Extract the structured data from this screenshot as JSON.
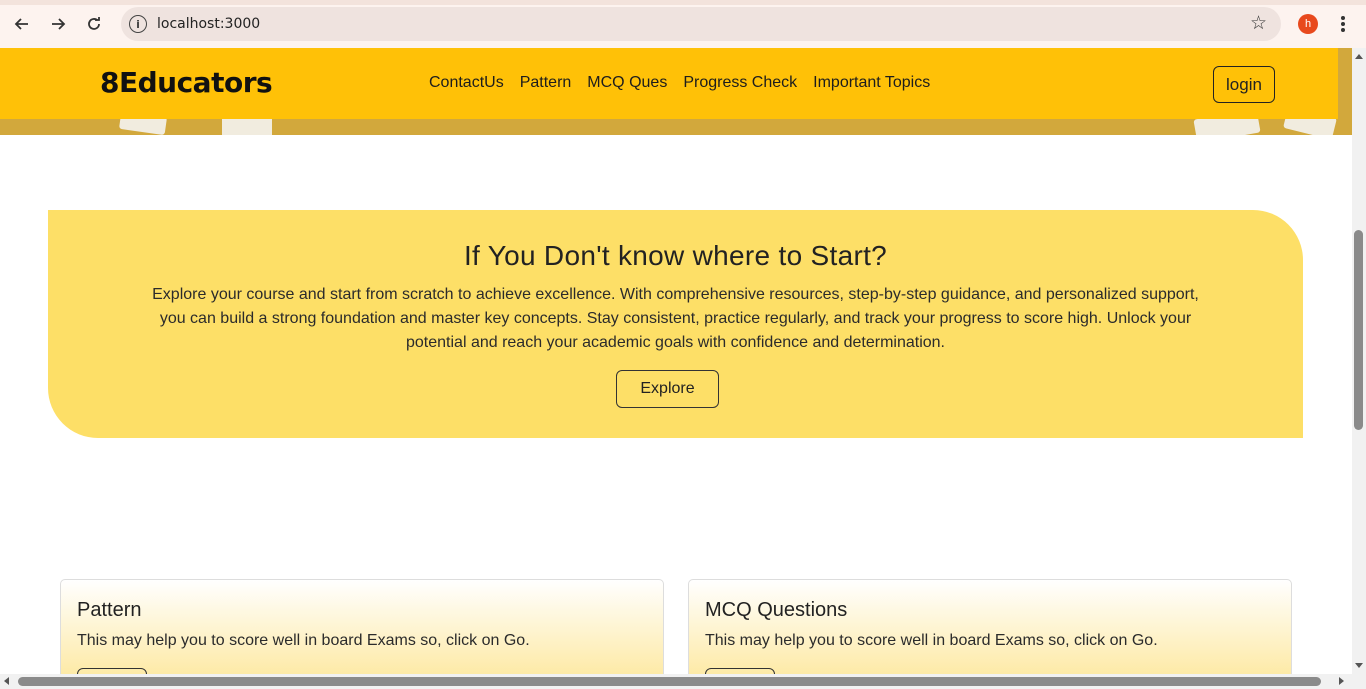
{
  "browser": {
    "url": "localhost:3000",
    "profile_initial": "h",
    "icons": [
      "back-arrow-icon",
      "forward-arrow-icon",
      "reload-icon",
      "info-icon",
      "star-icon",
      "kebab-menu-icon"
    ]
  },
  "navbar": {
    "brand": "8Educators",
    "links": [
      "ContactUs",
      "Pattern",
      "MCQ Ques",
      "Progress Check",
      "Important Topics"
    ],
    "login_label": "login",
    "background": "#ffc107"
  },
  "callout": {
    "title": "If You Don't know where to Start?",
    "body": "Explore your course and start from scratch to achieve excellence. With comprehensive resources, step-by-step guidance, and personalized support, you can build a strong foundation and master key concepts. Stay consistent, practice regularly, and track your progress to score high. Unlock your potential and reach your academic goals with confidence and determination.",
    "button_label": "Explore",
    "background": "#fddf67"
  },
  "cards": [
    {
      "title": "Pattern",
      "text": "This may help you to score well in board Exams so, click on Go."
    },
    {
      "title": "MCQ Questions",
      "text": "This may help you to score well in board Exams so, click on Go."
    }
  ]
}
